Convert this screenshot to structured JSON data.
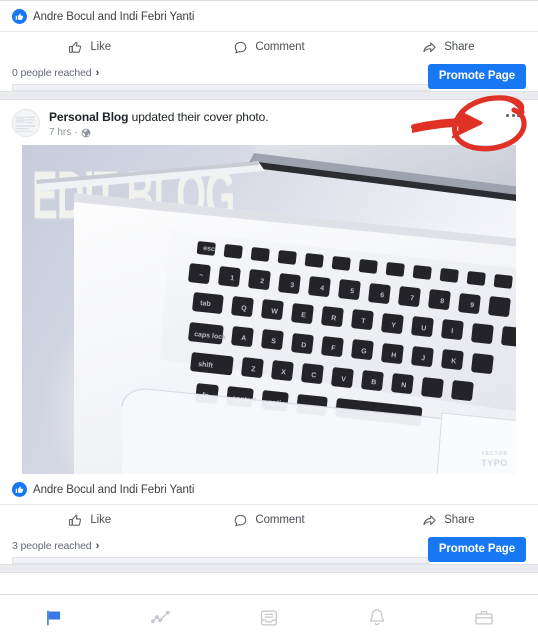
{
  "app": {
    "platform": "facebook-page-manager-mobile",
    "accent_color": "#1877f2",
    "annotation_color": "#e03127"
  },
  "posts": [
    {
      "id": "post-top",
      "reactions": {
        "badge_icon": "like-thumbs-up-icon",
        "text": "Andre Bocul and Indi Febri Yanti"
      },
      "actions": [
        {
          "icon": "thumbs-up-icon",
          "label": "Like"
        },
        {
          "icon": "comment-bubble-icon",
          "label": "Comment"
        },
        {
          "icon": "share-arrow-icon",
          "label": "Share"
        }
      ],
      "insights": {
        "reach_text": "0 people reached",
        "chevron": "›",
        "progress_percent": 0,
        "promote_label": "Promote Page"
      }
    },
    {
      "id": "post-cover-photo",
      "header": {
        "avatar_icon": "page-avatar",
        "page_name": "Personal Blog",
        "action_text": "updated their cover photo.",
        "timestamp": "7 hrs",
        "separator": "·",
        "privacy_icon": "globe-public-icon",
        "menu_icon": "more-options-icon"
      },
      "photo": {
        "overlay_text": "EDIT BLOG",
        "watermark": "TYPO",
        "watermark_sub": "VECTOR",
        "alt": "MacBook laptop keyboard on white desk"
      },
      "reactions": {
        "badge_icon": "like-thumbs-up-icon",
        "text": "Andre Bocul and Indi Febri Yanti"
      },
      "actions": [
        {
          "icon": "thumbs-up-icon",
          "label": "Like"
        },
        {
          "icon": "comment-bubble-icon",
          "label": "Comment"
        },
        {
          "icon": "share-arrow-icon",
          "label": "Share"
        }
      ],
      "insights": {
        "reach_text": "3 people reached",
        "chevron": "›",
        "progress_percent": 0,
        "promote_label": "Promote Page"
      }
    }
  ],
  "bottom_nav": {
    "active_index": 0,
    "items": [
      {
        "icon": "flag-pages-icon",
        "active": true
      },
      {
        "icon": "insights-line-chart-icon",
        "active": false
      },
      {
        "icon": "inbox-tray-icon",
        "active": false
      },
      {
        "icon": "bell-notifications-icon",
        "active": false
      },
      {
        "icon": "briefcase-business-icon",
        "active": false
      }
    ]
  },
  "annotation": {
    "shapes": [
      "arrow-pointing-right",
      "ellipse-circle-highlight"
    ],
    "target": "more-options-icon",
    "color": "#e03127"
  }
}
